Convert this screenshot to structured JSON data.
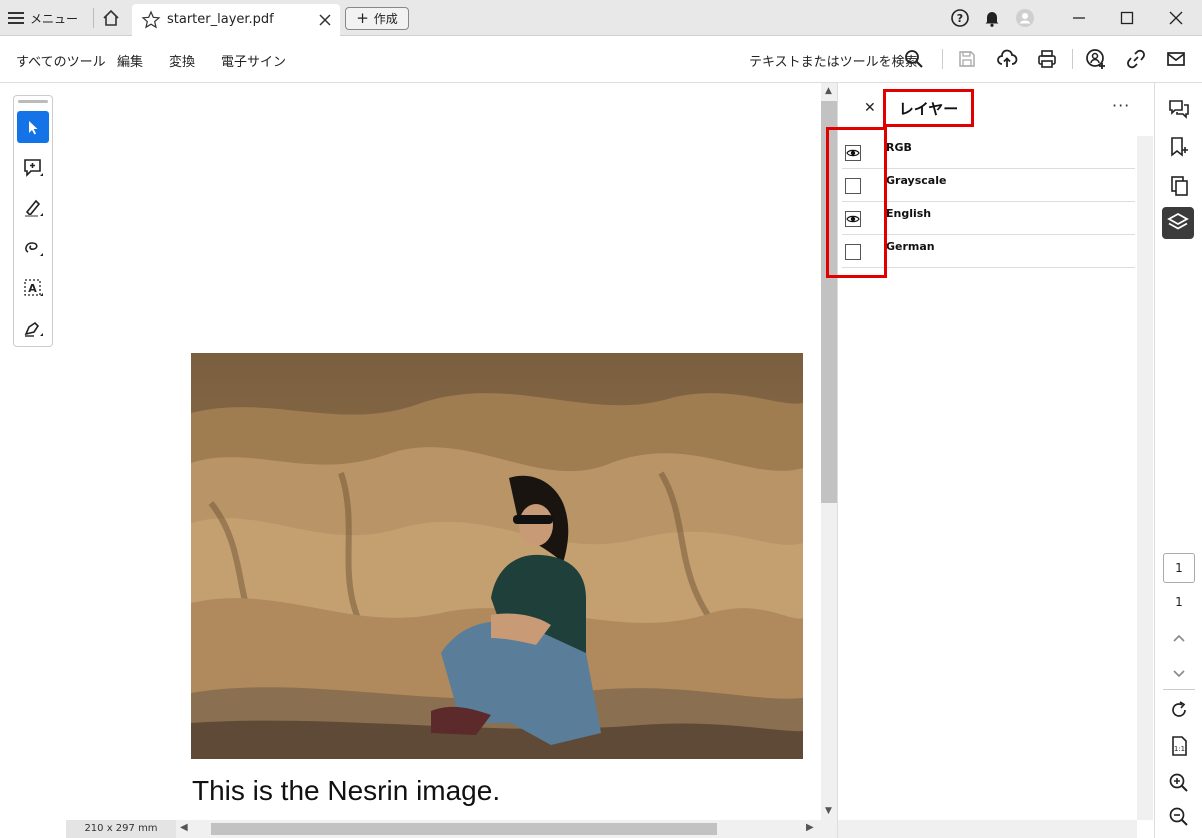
{
  "titlebar": {
    "menu_label": "メニュー",
    "tab_title": "starter_layer.pdf",
    "create_label": "作成"
  },
  "toolbar": {
    "menus": [
      "すべてのツール",
      "編集",
      "変換",
      "電子サイン"
    ],
    "search_label": "テキストまたはツールを検索"
  },
  "document": {
    "caption": "This is the Nesrin image.",
    "page_size": "210 x 297 mm"
  },
  "layers_panel": {
    "title": "レイヤー",
    "layers": [
      {
        "name": "RGB",
        "visible": true
      },
      {
        "name": "Grayscale",
        "visible": false
      },
      {
        "name": "English",
        "visible": true
      },
      {
        "name": "German",
        "visible": false
      }
    ]
  },
  "pagination": {
    "current_page": "1",
    "total_pages": "1"
  },
  "colors": {
    "accent": "#1473e6",
    "highlight": "#e00000"
  }
}
